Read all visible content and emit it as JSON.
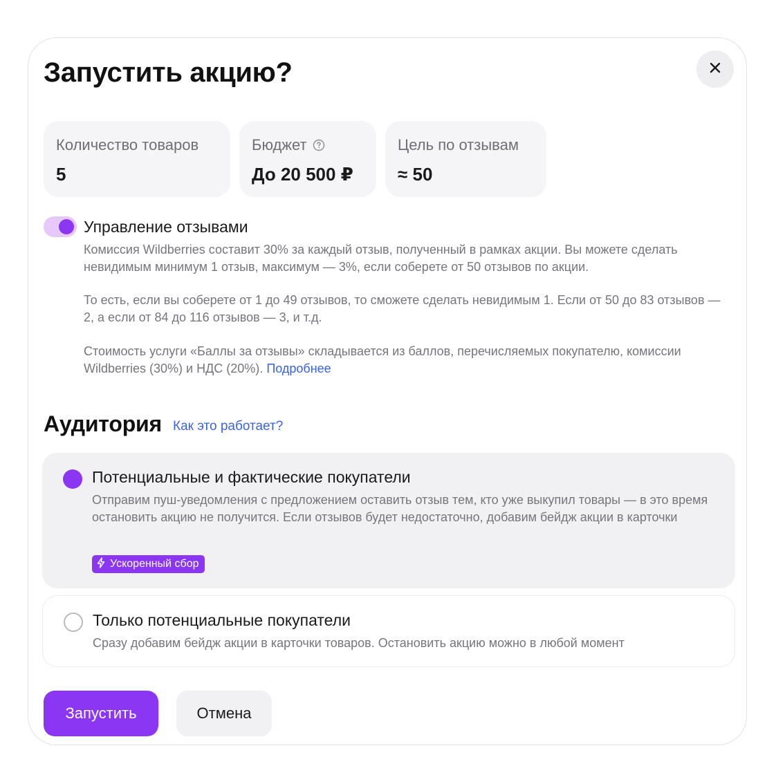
{
  "modal": {
    "title": "Запустить акцию?",
    "close_icon": "close-icon"
  },
  "stats": [
    {
      "label": "Количество товаров",
      "value": "5"
    },
    {
      "label": "Бюджет",
      "value": "До 20 500 ₽",
      "icon": "help-circle-icon"
    },
    {
      "label": "Цель по отзывам",
      "value": "≈ 50"
    }
  ],
  "review_management": {
    "toggle_on": true,
    "title": "Управление отзывами",
    "paragraph1": "Комиссия Wildberries составит 30% за каждый отзыв, полученный в рамках акции. Вы можете сделать невидимым минимум 1 отзыв, максимум — 3%, если соберете от 50 отзывов по акции.",
    "paragraph2": "То есть, если вы соберете от 1 до 49 отзывов, то сможете сделать невидимым 1. Если от 50 до 83 отзывов — 2, а если от 84 до 116 отзывов — 3, и т.д.",
    "paragraph3": "Стоимость услуги «Баллы за отзывы» складывается из баллов, перечисляемых покупателю, комиссии Wildberries (30%) и НДС (20%).",
    "more_link": "Подробнее"
  },
  "audience": {
    "title": "Аудитория",
    "help_link": "Как это работает?",
    "options": [
      {
        "title": "Потенциальные и фактические покупатели",
        "description": "Отправим пуш-уведомления с предложением оставить отзыв тем, кто уже выкупил товары — в это время остановить акцию не получится. Если отзывов будет недостаточно, добавим бейдж акции в карточки",
        "badge": "Ускоренный сбор",
        "badge_icon": "lightning-icon",
        "selected": true
      },
      {
        "title": "Только потенциальные покупатели",
        "description": "Сразу добавим бейдж акции в карточки товаров. Остановить акцию можно в любой момент",
        "selected": false
      }
    ]
  },
  "actions": {
    "primary": "Запустить",
    "secondary": "Отмена"
  },
  "colors": {
    "accent": "#8b36f2",
    "link": "#3a63e0",
    "toggle_track": "#e6c8fb",
    "card_bg": "#f5f5f7"
  }
}
